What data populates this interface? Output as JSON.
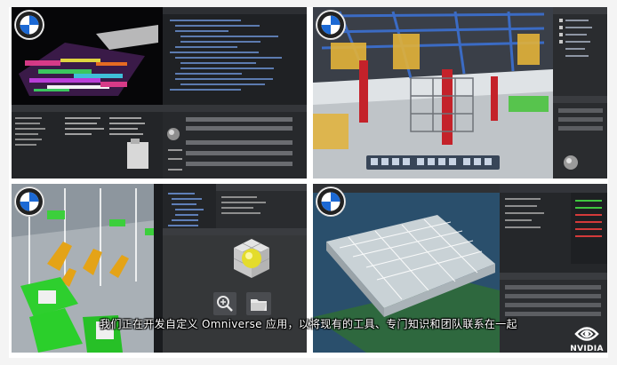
{
  "subtitle": "我们正在开发自定义 Omniverse 应用，以将现有的工具、专门知识和团队联系在一起",
  "brand_logo": "NVIDIA",
  "colors": {
    "bmw_blue": "#1c69d4",
    "nvidia_green": "#76b900",
    "panel_bg": "#1d1f22"
  },
  "icons": [
    "bmw-logo-icon",
    "zoom-in-icon",
    "folder-icon",
    "nvidia-eye-icon"
  ]
}
